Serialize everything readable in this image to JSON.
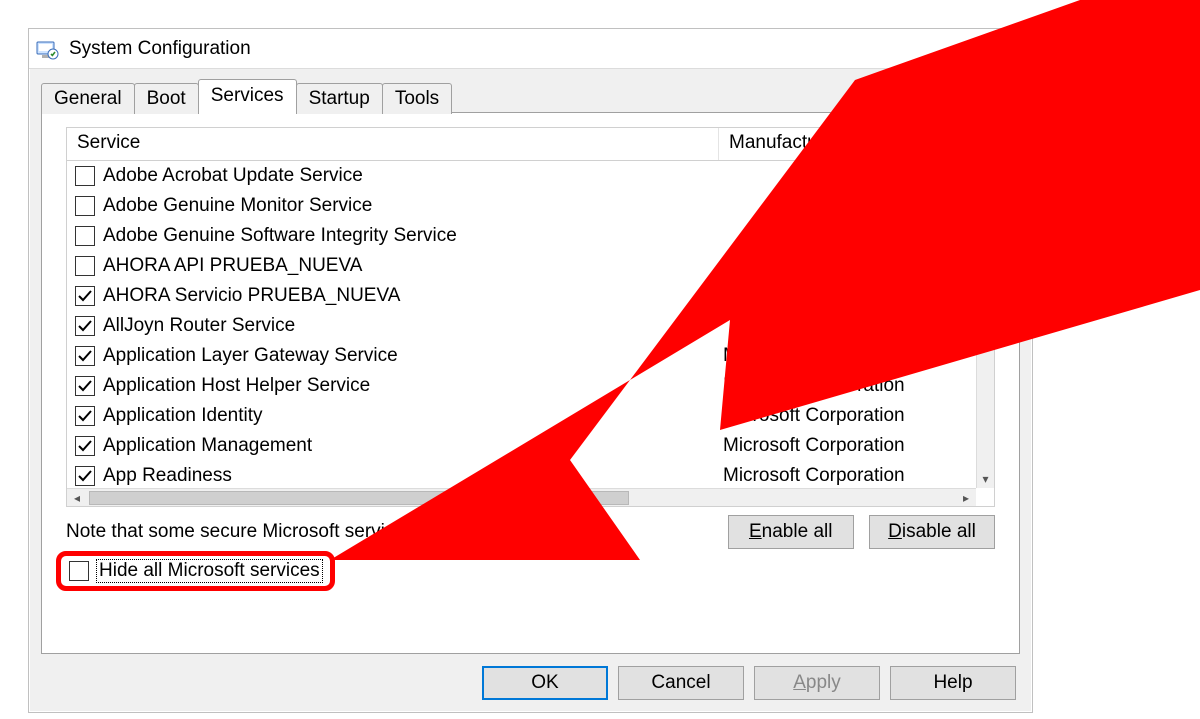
{
  "window": {
    "title": "System Configuration"
  },
  "tabs": [
    "General",
    "Boot",
    "Services",
    "Startup",
    "Tools"
  ],
  "active_tab_index": 2,
  "columns": {
    "service": "Service",
    "manufacturer": "Manufacturer"
  },
  "services": [
    {
      "checked": false,
      "name": "Adobe Acrobat Update Service",
      "manufacturer": ""
    },
    {
      "checked": false,
      "name": "Adobe Genuine Monitor Service",
      "manufacturer": ""
    },
    {
      "checked": false,
      "name": "Adobe Genuine Software Integrity Service",
      "manufacturer": ""
    },
    {
      "checked": false,
      "name": "AHORA API PRUEBA_NUEVA",
      "manufacturer": ""
    },
    {
      "checked": true,
      "name": "AHORA Servicio PRUEBA_NUEVA",
      "manufacturer": ""
    },
    {
      "checked": true,
      "name": "AllJoyn Router Service",
      "manufacturer": ""
    },
    {
      "checked": true,
      "name": "Application Layer Gateway Service",
      "manufacturer": "Microsoft Corporation"
    },
    {
      "checked": true,
      "name": "Application Host Helper Service",
      "manufacturer": "Microsoft Corporation"
    },
    {
      "checked": true,
      "name": "Application Identity",
      "manufacturer": "Microsoft Corporation"
    },
    {
      "checked": true,
      "name": "Application Management",
      "manufacturer": "Microsoft Corporation"
    },
    {
      "checked": true,
      "name": "App Readiness",
      "manufacturer": "Microsoft Corporation"
    }
  ],
  "note_text": "Note that some secure Microsoft services may not be disabled.",
  "buttons": {
    "enable_all": "Enable all",
    "disable_all": "Disable all",
    "hide_all_label": "Hide all Microsoft services",
    "ok": "OK",
    "cancel": "Cancel",
    "apply": "Apply",
    "help": "Help"
  },
  "hide_all_checked": false,
  "highlight_color": "#ff0000"
}
